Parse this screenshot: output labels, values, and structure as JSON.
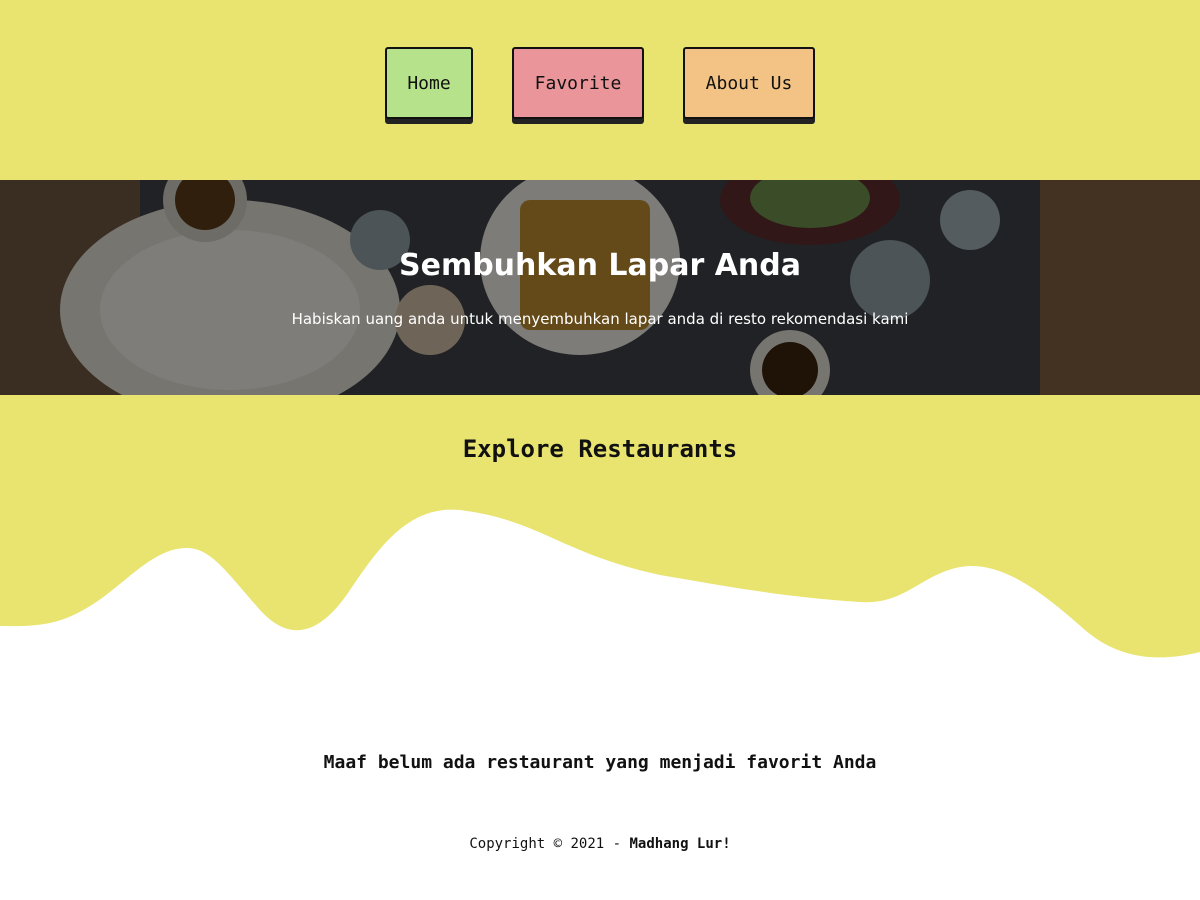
{
  "nav": {
    "items": [
      {
        "label": "Home",
        "color": "#b5e28a"
      },
      {
        "label": "Favorite",
        "color": "#e9959a"
      },
      {
        "label": "About Us",
        "color": "#f2c384"
      }
    ]
  },
  "hero": {
    "title": "Sembuhkan Lapar Anda",
    "subtitle": "Habiskan uang anda untuk menyembuhkan lapar anda di resto rekomendasi kami"
  },
  "explore": {
    "title": "Explore Restaurants"
  },
  "main": {
    "empty_message": "Maaf belum ada restaurant yang menjadi favorit Anda"
  },
  "footer": {
    "copyright_prefix": "Copyright © 2021 - ",
    "brand": "Madhang Lur!"
  },
  "colors": {
    "accent": "#e8e46f",
    "background": "#ffffff",
    "text": "#111111"
  }
}
